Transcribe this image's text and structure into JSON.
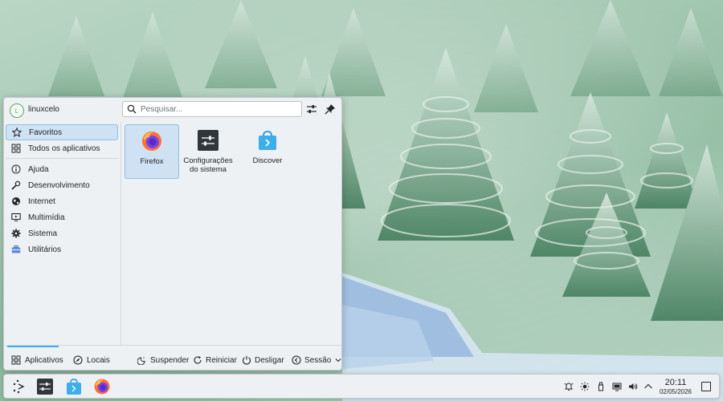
{
  "user": {
    "name": "linuxcelo",
    "avatar_letter": "L"
  },
  "search": {
    "placeholder": "Pesquisar..."
  },
  "header": {
    "configure_icon": "configure-icon",
    "pin_icon": "pin-icon"
  },
  "sidebar": {
    "items": [
      {
        "label": "Favoritos",
        "icon": "star-icon",
        "selected": true
      },
      {
        "label": "Todos os aplicativos",
        "icon": "grid-icon"
      },
      {
        "label": "Ajuda",
        "icon": "help-icon"
      },
      {
        "label": "Desenvolvimento",
        "icon": "wrench-icon"
      },
      {
        "label": "Internet",
        "icon": "globe-icon"
      },
      {
        "label": "Multimídia",
        "icon": "monitor-icon"
      },
      {
        "label": "Sistema",
        "icon": "gear-icon"
      },
      {
        "label": "Utilitários",
        "icon": "toolbox-icon"
      }
    ]
  },
  "favorites": [
    {
      "label": "Firefox",
      "icon": "firefox-icon",
      "selected": true
    },
    {
      "label": "Configurações do sistema",
      "icon": "system-settings-icon"
    },
    {
      "label": "Discover",
      "icon": "discover-icon"
    }
  ],
  "footer": {
    "tabs": [
      {
        "label": "Aplicativos",
        "icon": "apps-grid-icon",
        "active": true
      },
      {
        "label": "Locais",
        "icon": "compass-icon"
      }
    ],
    "power": [
      {
        "label": "Suspender",
        "icon": "suspend-icon"
      },
      {
        "label": "Reiniciar",
        "icon": "restart-icon"
      },
      {
        "label": "Desligar",
        "icon": "shutdown-icon"
      },
      {
        "label": "Sessão",
        "icon": "session-icon"
      }
    ]
  },
  "taskbar": {
    "pinned": [
      "launcher-icon",
      "system-settings-icon",
      "discover-icon",
      "firefox-icon"
    ],
    "tray": [
      "notification-bell-icon",
      "brightness-icon",
      "usb-icon",
      "clipboard-icon",
      "volume-icon",
      "chevron-up-icon"
    ],
    "clock": {
      "time": "20:11",
      "date": "02/05/2026"
    }
  },
  "colors": {
    "accent": "#3daee9",
    "selection": "#cfe2f3",
    "panel": "#eef1f4"
  }
}
